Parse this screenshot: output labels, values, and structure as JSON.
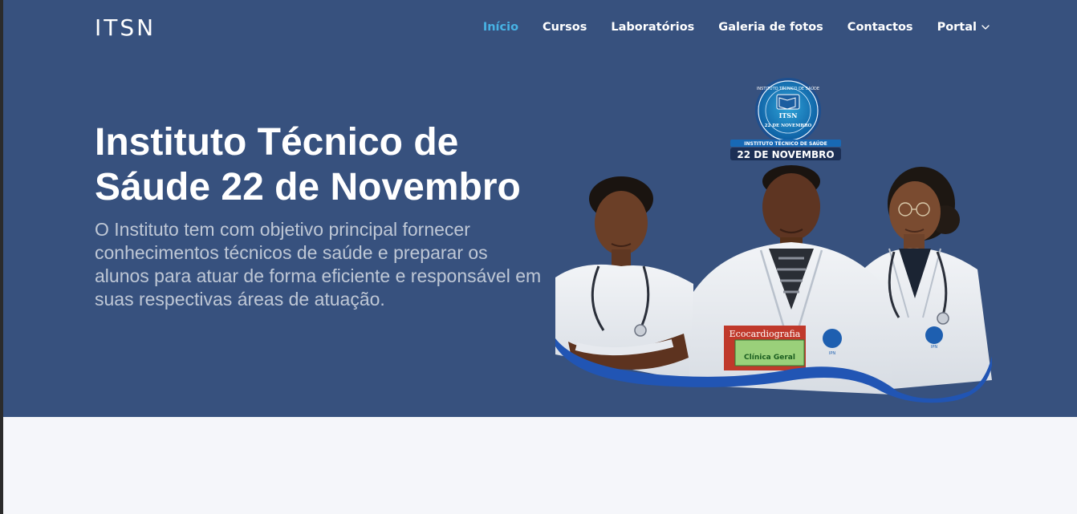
{
  "brand": {
    "logo": "ITSN"
  },
  "nav": {
    "items": [
      {
        "label": "Início",
        "active": true
      },
      {
        "label": "Cursos",
        "active": false
      },
      {
        "label": "Laboratórios",
        "active": false
      },
      {
        "label": "Galeria de fotos",
        "active": false
      },
      {
        "label": "Contactos",
        "active": false
      },
      {
        "label": "Portal",
        "active": false,
        "dropdown": true
      }
    ]
  },
  "hero": {
    "title": "Instituto Técnico de Sáude 22 de Novembro",
    "description": "O Instituto tem com objetivo principal fornecer conhecimentos técnicos de saúde e preparar os alunos para atuar de forma eficiente e responsável em suas respectivas áreas de atuação.",
    "image": {
      "seal_text": "INSTITUTO TÉCNICO DE SAÚDE",
      "seal_abbrev": "ITSN",
      "seal_date": "22 DE NOVEMBRO",
      "banner_top": "INSTITUTO TÉCNICO DE SAÚDE",
      "banner_main": "22 DE NOVEMBRO",
      "book_1": "Ecocardiografia",
      "book_2": "Clínica Geral",
      "coat_badge": "IPN"
    }
  },
  "colors": {
    "hero_bg": "#37517e",
    "accent": "#47b2e4",
    "page_bg": "#f5f6fa"
  }
}
